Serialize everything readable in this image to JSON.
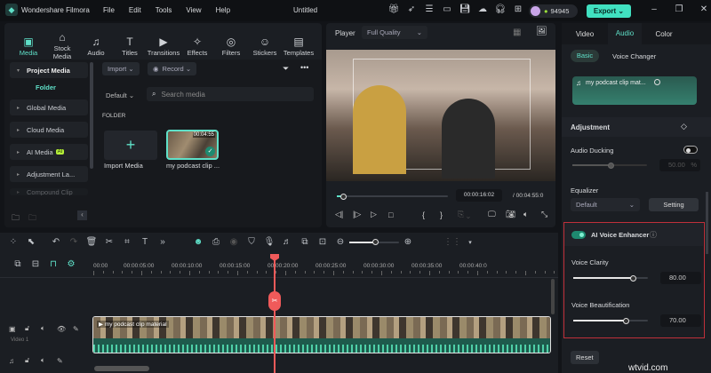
{
  "app": {
    "name": "Wondershare Filmora",
    "project_title": "Untitled",
    "menu": [
      "File",
      "Edit",
      "Tools",
      "View",
      "Help"
    ],
    "coins": "94945",
    "export_label": "Export"
  },
  "media_toolbar": [
    {
      "label": "Media",
      "icon": "▣"
    },
    {
      "label": "Stock Media",
      "icon": "⌂"
    },
    {
      "label": "Audio",
      "icon": "♫"
    },
    {
      "label": "Titles",
      "icon": "T"
    },
    {
      "label": "Transitions",
      "icon": "▶"
    },
    {
      "label": "Effects",
      "icon": "✧"
    },
    {
      "label": "Filters",
      "icon": "◎"
    },
    {
      "label": "Stickers",
      "icon": "☺"
    },
    {
      "label": "Templates",
      "icon": "▤"
    }
  ],
  "sidebar": {
    "project_media": "Project Media",
    "folder": "Folder",
    "items": [
      "Global Media",
      "Cloud Media",
      "AI Media",
      "Adjustment La...",
      "Compound Clip"
    ],
    "ai_badge": "AI"
  },
  "media": {
    "import": "Import",
    "record": "Record",
    "sort": "Default",
    "search_placeholder": "Search media",
    "folder_label": "FOLDER",
    "import_media": "Import Media",
    "clip_name": "my podcast clip ...",
    "clip_duration": "00:04:55"
  },
  "player": {
    "label": "Player",
    "quality": "Full Quality",
    "current_time": "00:00:16:02",
    "total_time": "/ 00:04:55:0",
    "progress": 0.05
  },
  "right_panel": {
    "tabs": [
      "Video",
      "Audio",
      "Color"
    ],
    "active_tab": "Audio",
    "subtabs": [
      "Basic",
      "Voice Changer"
    ],
    "clip_name": "my podcast clip mat...",
    "adjustment": "Adjustment",
    "audio_ducking": "Audio Ducking",
    "ducking_value": "50.00",
    "ducking_unit": "%",
    "equalizer": "Equalizer",
    "eq_preset": "Default",
    "setting": "Setting",
    "ai_voice_enhancer": "AI Voice Enhancer",
    "voice_clarity": "Voice Clarity",
    "voice_clarity_value": "80.00",
    "voice_beautification": "Voice Beautification",
    "voice_beautification_value": "70.00",
    "reset": "Reset",
    "accent": "#40e0c0",
    "highlight_border": "#c0303a"
  },
  "timeline": {
    "ticks": [
      "00:00",
      "00:00:05:00",
      "00:00:10:00",
      "00:00:15:00",
      "00:00:20:00",
      "00:00:25:00",
      "00:00:30:00",
      "00:00:35:00",
      "00:00:40:0"
    ],
    "clip_label": "my podcast clip material",
    "video_track": "Video 1",
    "playhead_color": "#f05a5a"
  },
  "watermark": "wtvid.com"
}
